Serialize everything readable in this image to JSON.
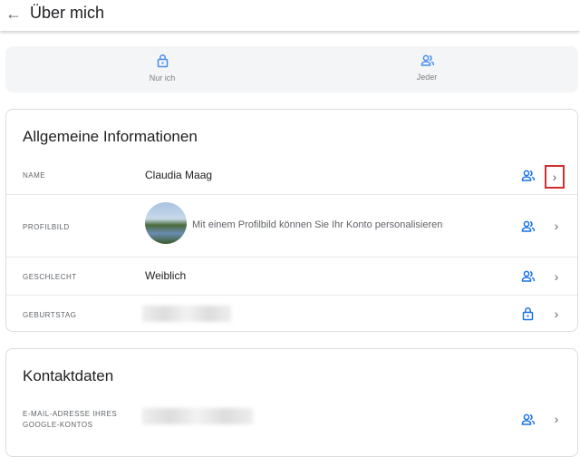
{
  "header": {
    "title": "Über mich"
  },
  "legend": {
    "only_me": "Nur ich",
    "everyone": "Jeder"
  },
  "general": {
    "title": "Allgemeine Informationen",
    "rows": [
      {
        "label": "NAME",
        "value": "Claudia Maag",
        "visibility": "people-icon"
      },
      {
        "label": "PROFILBILD",
        "value": "Mit einem Profilbild können Sie Ihr Konto personalisieren",
        "visibility": "people-icon"
      },
      {
        "label": "GESCHLECHT",
        "value": "Weiblich",
        "visibility": "people-icon"
      },
      {
        "label": "GEBURTSTAG",
        "value": null,
        "visibility": "lock-icon"
      }
    ]
  },
  "contact": {
    "title": "Kontaktdaten",
    "rows": [
      {
        "label": "E-MAIL-ADRESSE IHRES GOOGLE-KONTOS",
        "visibility": "people-icon"
      }
    ]
  },
  "colors": {
    "accent": "#1a73e8",
    "highlight": "#d32f2f"
  }
}
